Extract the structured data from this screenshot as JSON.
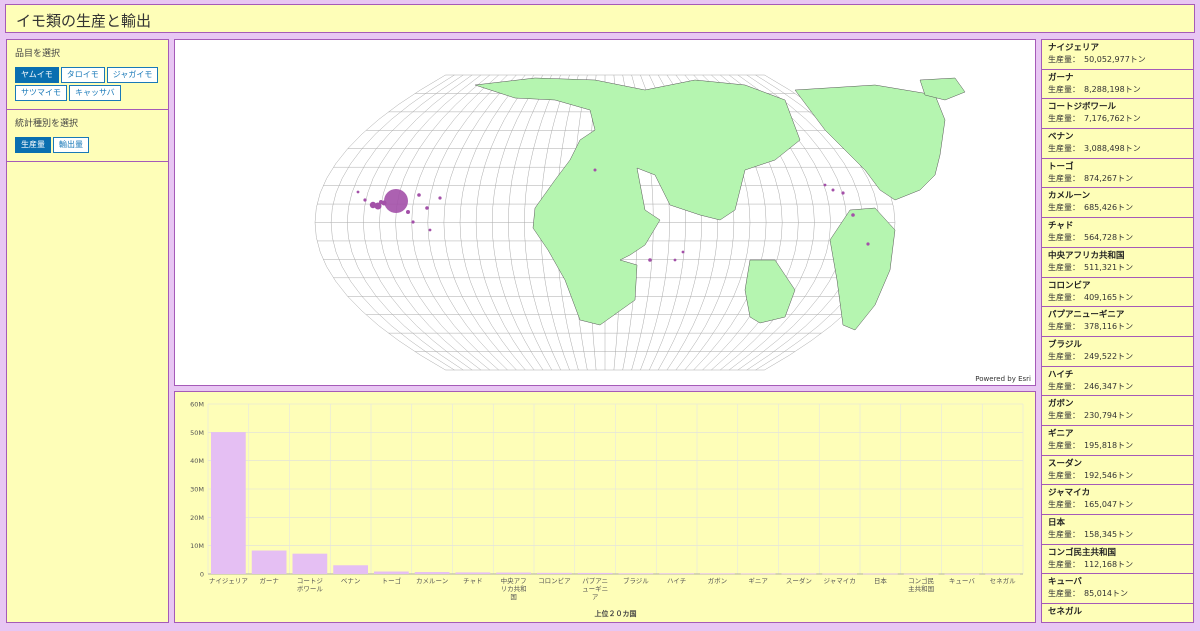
{
  "header": {
    "title": "イモ類の生産と輸出"
  },
  "sidebar": {
    "item_section_label": "品目を選択",
    "items": [
      {
        "label": "ヤムイモ",
        "active": true
      },
      {
        "label": "タロイモ",
        "active": false
      },
      {
        "label": "ジャガイモ",
        "active": false
      },
      {
        "label": "サツマイモ",
        "active": false
      },
      {
        "label": "キャッサバ",
        "active": false
      }
    ],
    "stat_section_label": "統計種別を選択",
    "stats": [
      {
        "label": "生産量",
        "active": true
      },
      {
        "label": "輸出量",
        "active": false
      }
    ]
  },
  "map": {
    "attribution": "Powered by Esri"
  },
  "ranking": {
    "value_label": "生産量：",
    "entries": [
      {
        "name": "ナイジェリア",
        "value": "50,052,977トン"
      },
      {
        "name": "ガーナ",
        "value": "8,288,198トン"
      },
      {
        "name": "コートジボワール",
        "value": "7,176,762トン"
      },
      {
        "name": "ベナン",
        "value": "3,088,498トン"
      },
      {
        "name": "トーゴ",
        "value": "874,267トン"
      },
      {
        "name": "カメルーン",
        "value": "685,426トン"
      },
      {
        "name": "チャド",
        "value": "564,728トン"
      },
      {
        "name": "中央アフリカ共和国",
        "value": "511,321トン"
      },
      {
        "name": "コロンビア",
        "value": "409,165トン"
      },
      {
        "name": "パプアニューギニア",
        "value": "378,116トン"
      },
      {
        "name": "ブラジル",
        "value": "249,522トン"
      },
      {
        "name": "ハイチ",
        "value": "246,347トン"
      },
      {
        "name": "ガボン",
        "value": "230,794トン"
      },
      {
        "name": "ギニア",
        "value": "195,818トン"
      },
      {
        "name": "スーダン",
        "value": "192,546トン"
      },
      {
        "name": "ジャマイカ",
        "value": "165,047トン"
      },
      {
        "name": "日本",
        "value": "158,345トン"
      },
      {
        "name": "コンゴ民主共和国",
        "value": "112,168トン"
      },
      {
        "name": "キューバ",
        "value": "85,014トン"
      },
      {
        "name": "セネガル",
        "value": ""
      }
    ]
  },
  "chart_data": {
    "type": "bar",
    "xlabel": "上位２０カ国",
    "ylabel": "",
    "ylim": [
      0,
      60000000
    ],
    "yticks": [
      "0",
      "10M",
      "20M",
      "30M",
      "40M",
      "50M",
      "60M"
    ],
    "bar_color": "#e5bff3",
    "categories": [
      [
        "ナイジェリア"
      ],
      [
        "ガーナ"
      ],
      [
        "コートジ",
        "ボワール"
      ],
      [
        "ベナン"
      ],
      [
        "トーゴ"
      ],
      [
        "カメルーン"
      ],
      [
        "チャド"
      ],
      [
        "中央アフ",
        "リカ共和",
        "国"
      ],
      [
        "コロンビア"
      ],
      [
        "パプアニ",
        "ューギニ",
        "ア"
      ],
      [
        "ブラジル"
      ],
      [
        "ハイチ"
      ],
      [
        "ガボン"
      ],
      [
        "ギニア"
      ],
      [
        "スーダン"
      ],
      [
        "ジャマイカ"
      ],
      [
        "日本"
      ],
      [
        "コンゴ民",
        "主共和国"
      ],
      [
        "キューバ"
      ],
      [
        "セネガル"
      ]
    ],
    "values": [
      50052977,
      8288198,
      7176762,
      3088498,
      874267,
      685426,
      564728,
      511321,
      409165,
      378116,
      249522,
      246347,
      230794,
      195818,
      192546,
      165047,
      158345,
      112168,
      85014,
      80000
    ]
  }
}
